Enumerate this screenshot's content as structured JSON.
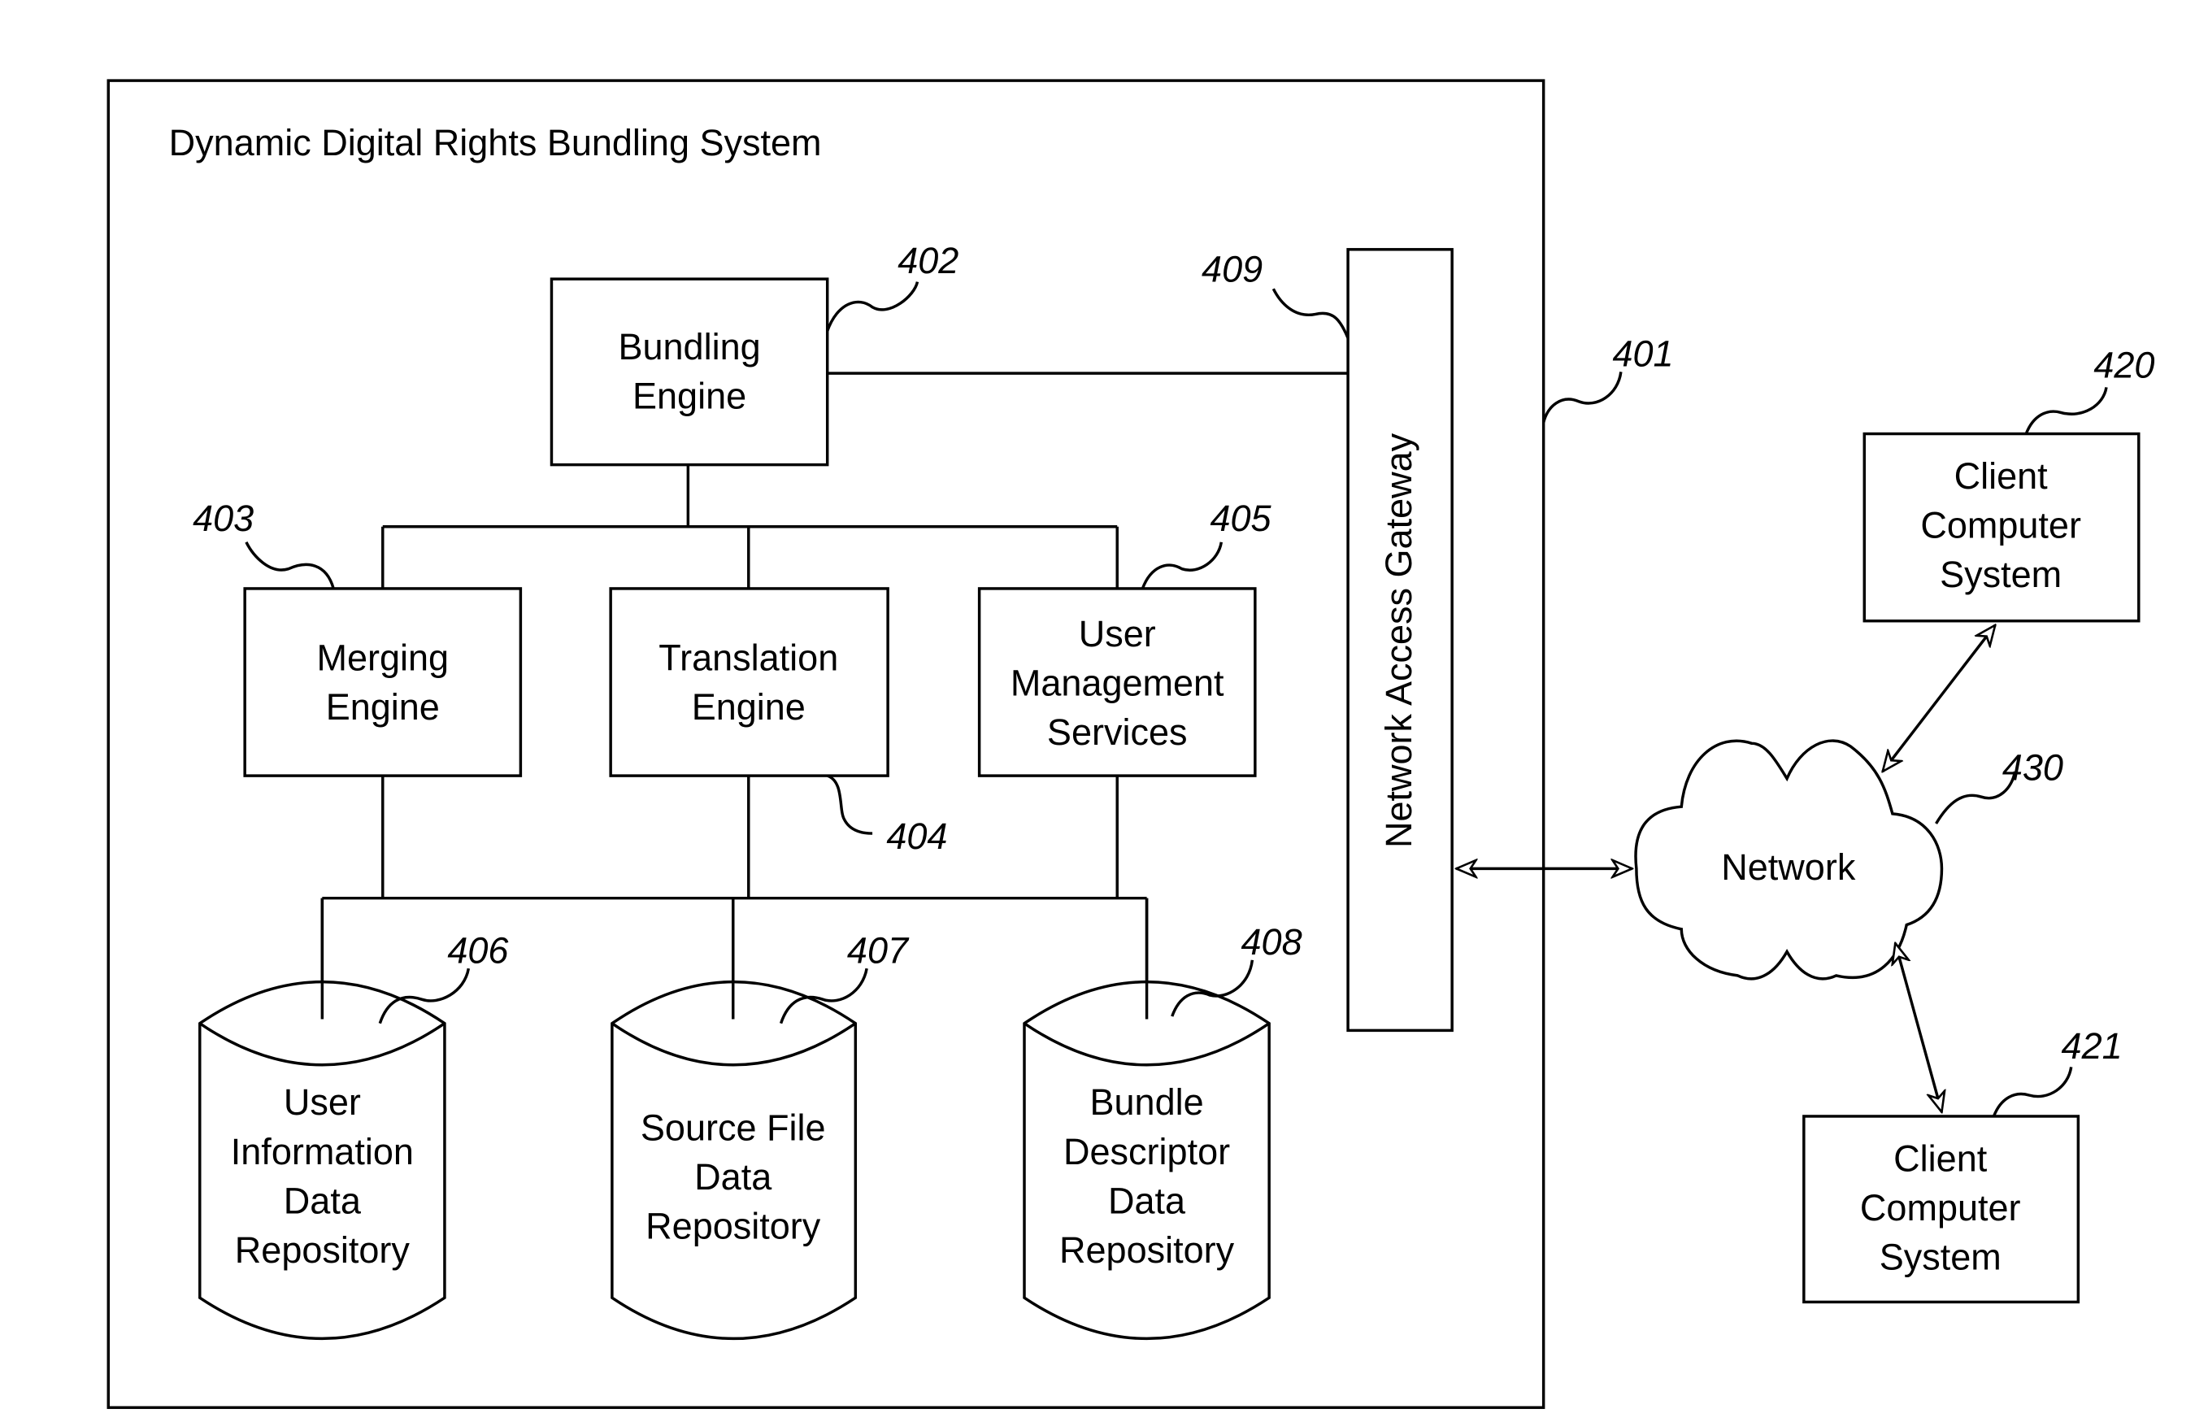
{
  "diagram": {
    "system_title": "Dynamic Digital Rights Bundling System",
    "system_ref": "401",
    "nodes": {
      "bundling_engine": {
        "lines": [
          "Bundling",
          "Engine"
        ],
        "ref": "402"
      },
      "merging_engine": {
        "lines": [
          "Merging",
          "Engine"
        ],
        "ref": "403"
      },
      "translation_engine": {
        "lines": [
          "Translation",
          "Engine"
        ],
        "ref": "404"
      },
      "user_management": {
        "lines": [
          "User",
          "Management",
          "Services"
        ],
        "ref": "405"
      },
      "user_info_repo": {
        "lines": [
          "User",
          "Information",
          "Data",
          "Repository"
        ],
        "ref": "406"
      },
      "source_file_repo": {
        "lines": [
          "Source File",
          "Data",
          "Repository"
        ],
        "ref": "407"
      },
      "bundle_descriptor_repo": {
        "lines": [
          "Bundle",
          "Descriptor",
          "Data",
          "Repository"
        ],
        "ref": "408"
      },
      "network_gateway": {
        "label": "Network Access Gateway",
        "ref": "409"
      },
      "network": {
        "label": "Network",
        "ref": "430"
      },
      "client_1": {
        "lines": [
          "Client",
          "Computer",
          "System"
        ],
        "ref": "420"
      },
      "client_2": {
        "lines": [
          "Client",
          "Computer",
          "System"
        ],
        "ref": "421"
      }
    }
  }
}
